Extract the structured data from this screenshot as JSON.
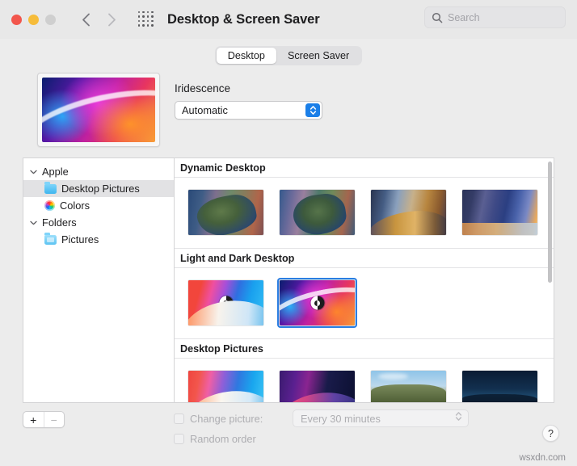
{
  "window": {
    "title": "Desktop & Screen Saver",
    "traffic_lights": [
      "close",
      "minimize",
      "zoom-disabled"
    ],
    "nav_back_icon": "chevron-left-icon",
    "nav_forward_icon": "chevron-right-icon",
    "grid_icon": "show-all-grid-icon",
    "search": {
      "placeholder": "Search",
      "value": "",
      "icon": "search-icon"
    }
  },
  "tabs": [
    {
      "label": "Desktop",
      "active": true
    },
    {
      "label": "Screen Saver",
      "active": false
    }
  ],
  "top": {
    "preview_name": "current-wallpaper-preview",
    "iridescence_label": "Iridescence",
    "popup_value": "Automatic",
    "popup_icon": "stepper-updown-icon"
  },
  "sidebar": {
    "groups": [
      {
        "label": "Apple",
        "disclosure": "chevron-down-icon",
        "items": [
          {
            "label": "Desktop Pictures",
            "icon": "folder-icon",
            "selected": true
          },
          {
            "label": "Colors",
            "icon": "color-wheel-icon",
            "selected": false
          }
        ]
      },
      {
        "label": "Folders",
        "disclosure": "chevron-down-icon",
        "items": [
          {
            "label": "Pictures",
            "icon": "folder-pictures-icon",
            "selected": false
          }
        ]
      }
    ]
  },
  "content": {
    "sections": [
      {
        "title": "Dynamic Desktop",
        "thumbs": [
          {
            "name": "catalina-dynamic",
            "art": "w-catalina",
            "badge": false,
            "selected": false
          },
          {
            "name": "catalina-island-dynamic",
            "art": "w-catalina2",
            "badge": false,
            "selected": false
          },
          {
            "name": "mojave-dynamic",
            "art": "w-mojave",
            "badge": false,
            "selected": false
          },
          {
            "name": "solar-gradients-dynamic",
            "art": "w-solar",
            "badge": false,
            "selected": false
          }
        ]
      },
      {
        "title": "Light and Dark Desktop",
        "thumbs": [
          {
            "name": "big-sur-light-dark",
            "art": "w-bigsur",
            "badge": true,
            "selected": false
          },
          {
            "name": "iridescence-light-dark",
            "art": "w-iridescence",
            "badge": true,
            "selected": true
          }
        ]
      },
      {
        "title": "Desktop Pictures",
        "thumbs": [
          {
            "name": "big-sur-graphic",
            "art": "w-montery-light",
            "badge": false,
            "selected": false
          },
          {
            "name": "big-sur-graphic-dark",
            "art": "w-montery-dark",
            "badge": false,
            "selected": false
          },
          {
            "name": "hills-photo",
            "art": "w-hills",
            "badge": false,
            "selected": false
          },
          {
            "name": "night-photo",
            "art": "w-night",
            "badge": false,
            "selected": false
          }
        ]
      }
    ]
  },
  "bottom": {
    "add_label": "+",
    "remove_label": "−",
    "change_picture_label": "Change picture:",
    "change_picture_checked": false,
    "random_order_label": "Random order",
    "random_order_checked": false,
    "interval_value": "Every 30 minutes",
    "interval_disabled": true,
    "help_label": "?",
    "watermark": "wsxdn.com"
  },
  "colors": {
    "accent": "#1b7fe8",
    "selection": "#2a7de1",
    "window_bg": "#ececec",
    "disabled_text": "#aeaeb2"
  }
}
